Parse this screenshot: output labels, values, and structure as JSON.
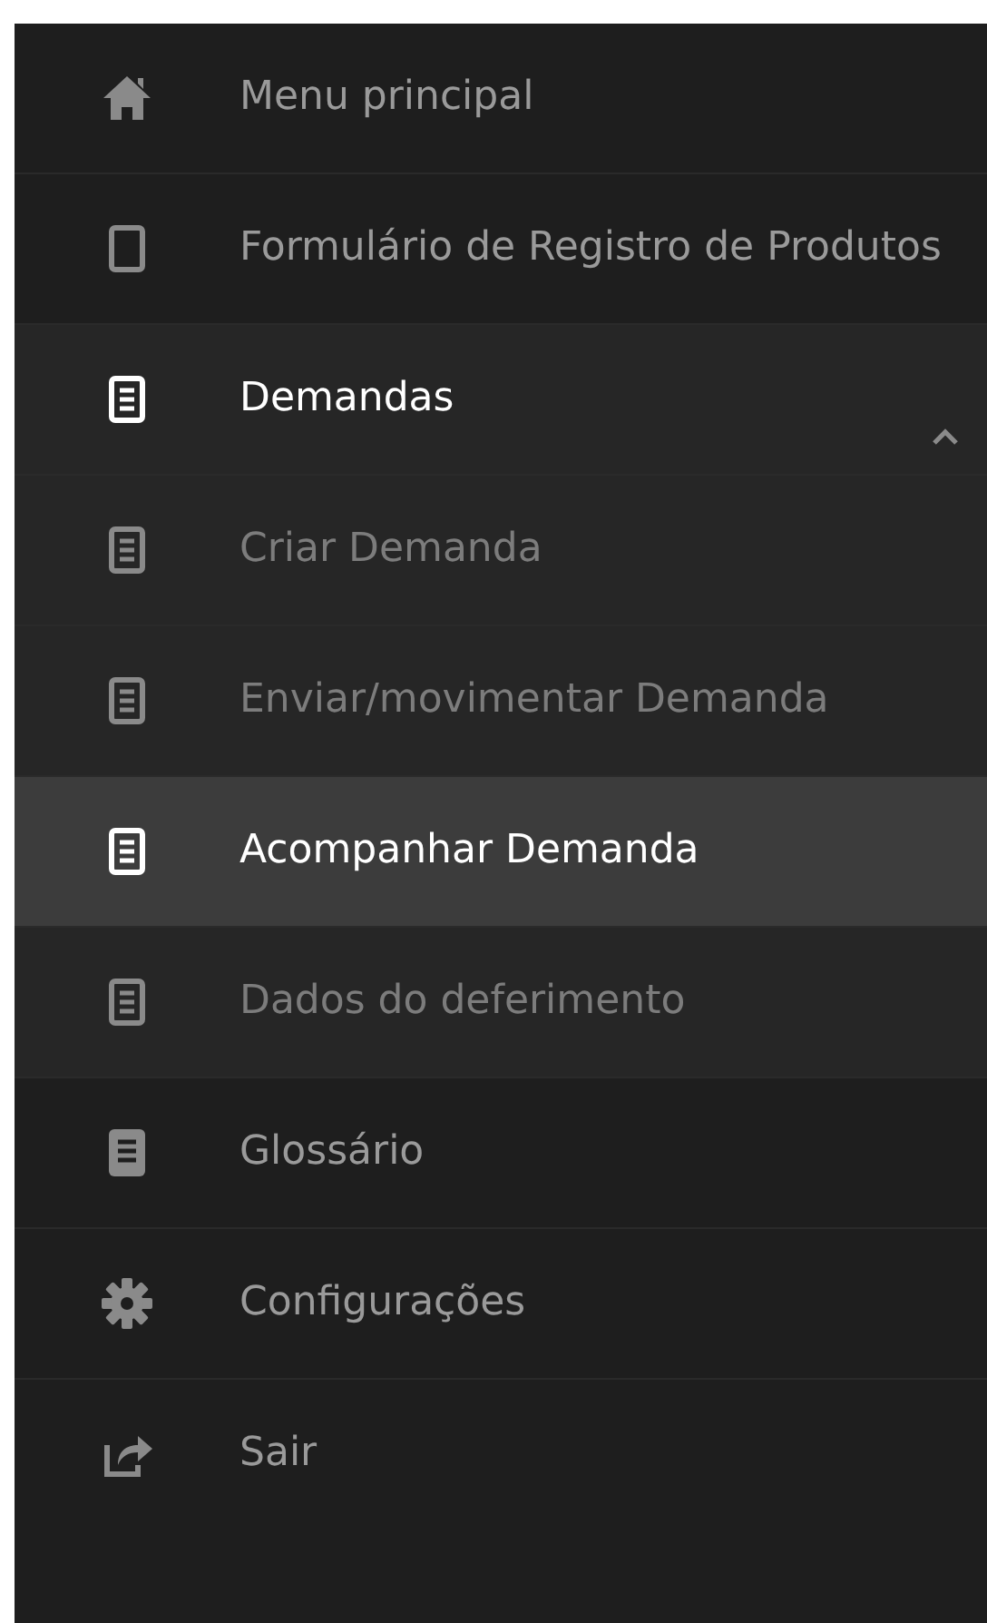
{
  "menu": [
    {
      "label": "Menu principal",
      "kind": "home",
      "selected": false
    },
    {
      "label": "Formulário de Registro de Produtos",
      "kind": "form",
      "selected": false
    },
    {
      "label": "Demandas",
      "kind": "document",
      "selected": false,
      "expanded": true,
      "children": [
        {
          "label": "Criar Demanda",
          "kind": "document",
          "selected": false
        },
        {
          "label": "Enviar/movimentar Demanda",
          "kind": "document",
          "selected": false
        },
        {
          "label": "Acompanhar Demanda",
          "kind": "document",
          "selected": true
        },
        {
          "label": "Dados do deferimento",
          "kind": "document",
          "selected": false
        }
      ]
    },
    {
      "label": "Glossário",
      "kind": "glossary",
      "selected": false
    },
    {
      "label": "Configurações",
      "kind": "settings",
      "selected": false
    },
    {
      "label": "Sair",
      "kind": "logout",
      "selected": false
    }
  ]
}
